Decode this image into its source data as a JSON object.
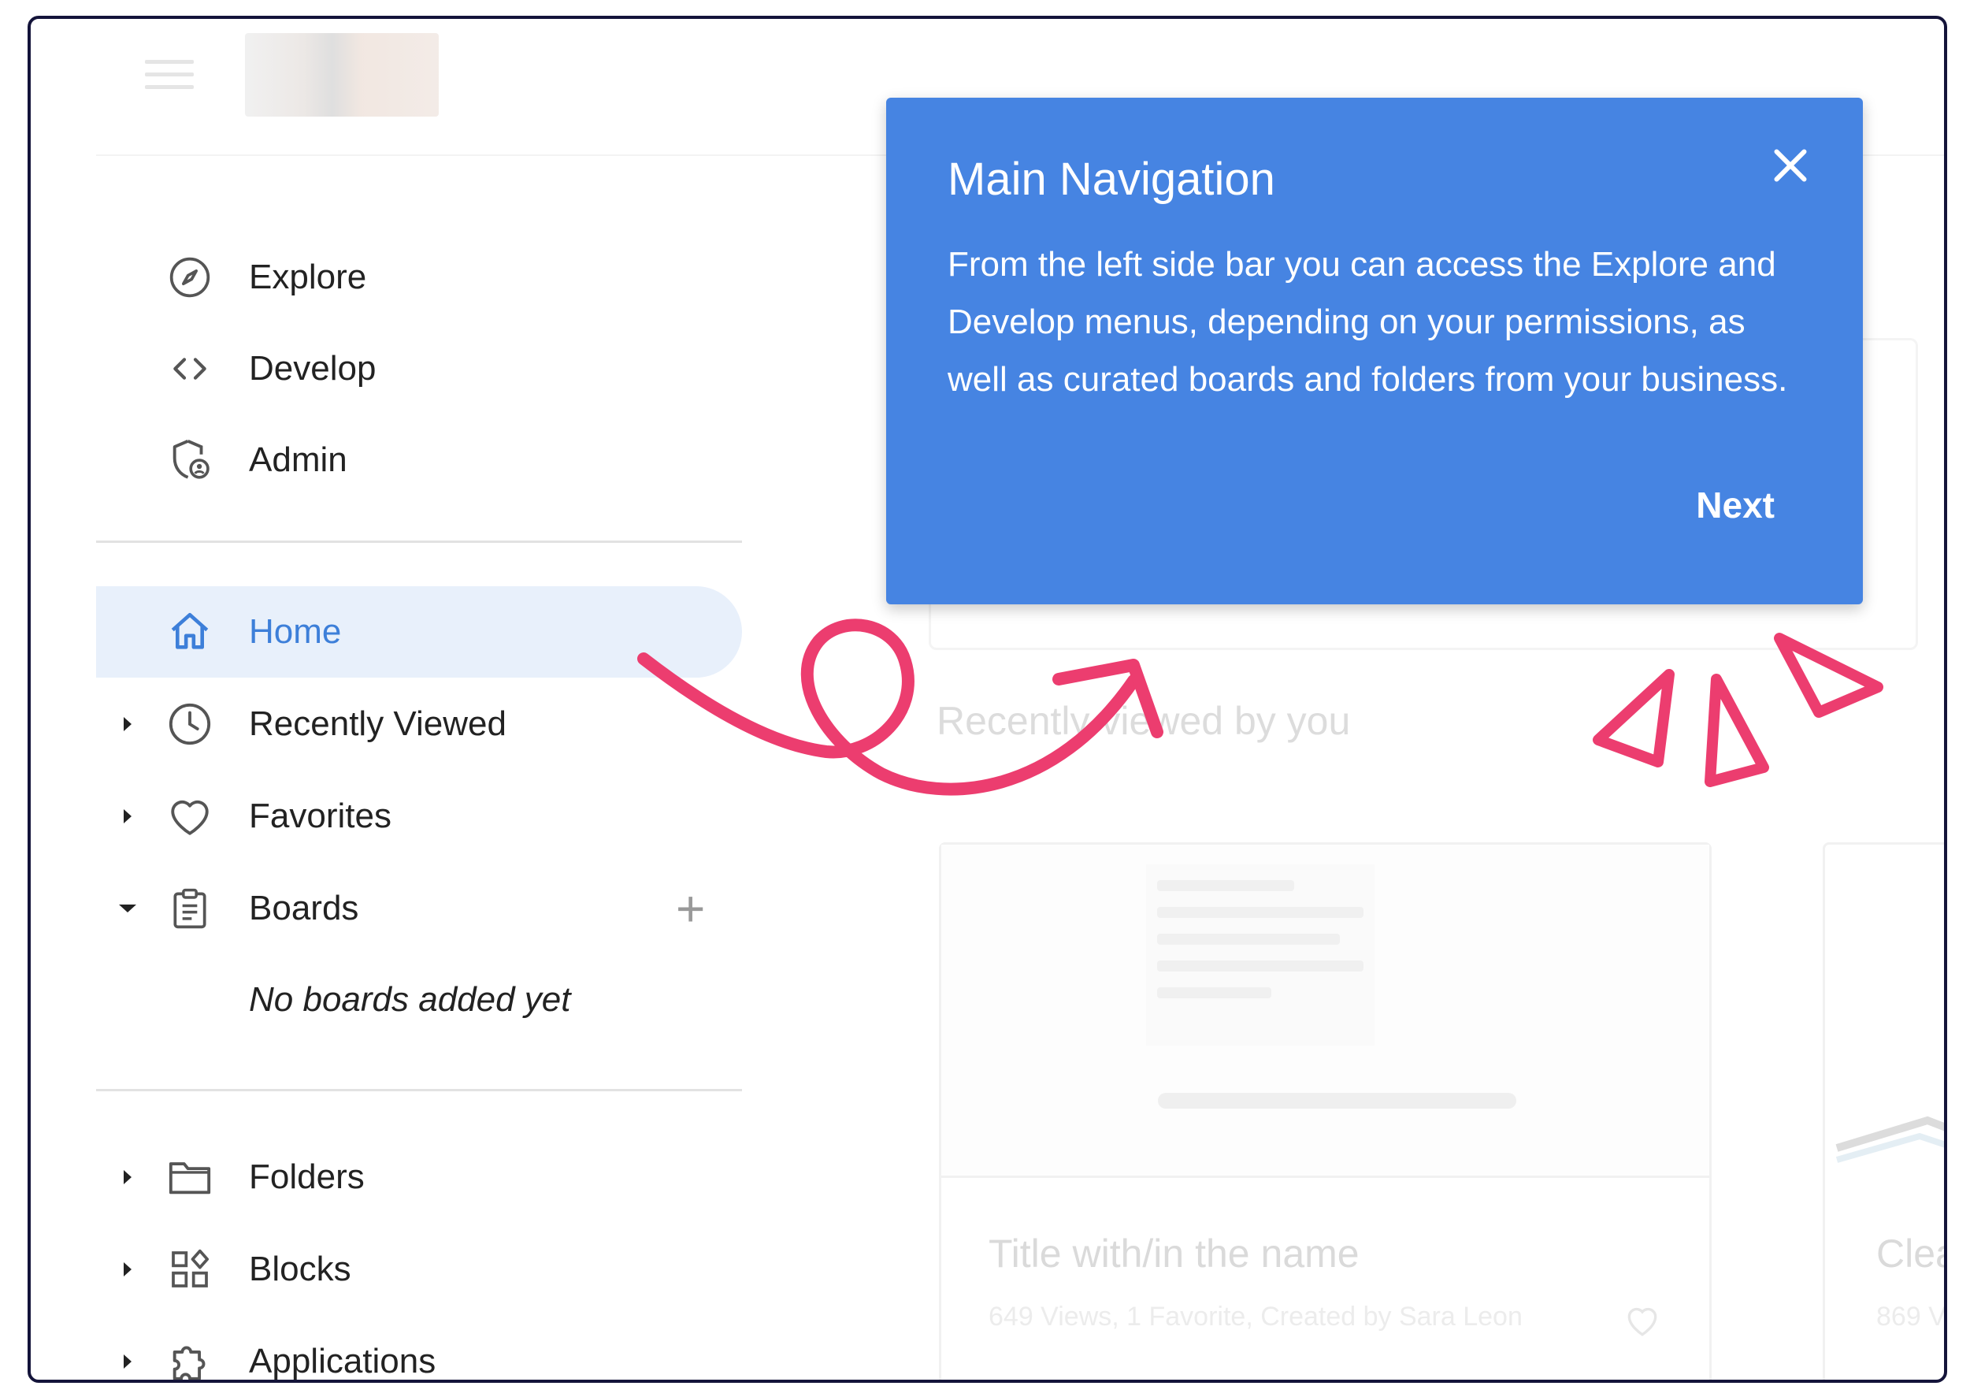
{
  "sidebar": {
    "top_items": [
      {
        "label": "Explore",
        "icon": "compass-icon"
      },
      {
        "label": "Develop",
        "icon": "code-icon"
      },
      {
        "label": "Admin",
        "icon": "admin-shield-icon"
      }
    ],
    "home": {
      "label": "Home",
      "icon": "home-icon"
    },
    "recently_viewed": {
      "label": "Recently Viewed",
      "icon": "clock-icon"
    },
    "favorites": {
      "label": "Favorites",
      "icon": "heart-icon"
    },
    "boards": {
      "label": "Boards",
      "icon": "clipboard-icon",
      "add": "+",
      "empty": "No boards added yet"
    },
    "bottom_items": [
      {
        "label": "Folders",
        "icon": "folder-icon"
      },
      {
        "label": "Blocks",
        "icon": "blocks-icon"
      },
      {
        "label": "Applications",
        "icon": "puzzle-icon"
      }
    ]
  },
  "main": {
    "section_heading": "Recently viewed by you",
    "cards": [
      {
        "title": "Title with/in the name",
        "meta": "649 Views, 1 Favorite, Created by Sara Leon"
      },
      {
        "title": "Clea",
        "meta": "869 V"
      }
    ]
  },
  "tooltip": {
    "title": "Main Navigation",
    "body": "From the left side bar you can access the Explore and Develop menus, depending on your permissions, as well as curated boards and folders from your business.",
    "next": "Next"
  },
  "colors": {
    "accent": "#4684e2",
    "active_bg": "#e8f0fb",
    "active_text": "#3d7fd9",
    "annotation": "#ec3d6f"
  }
}
